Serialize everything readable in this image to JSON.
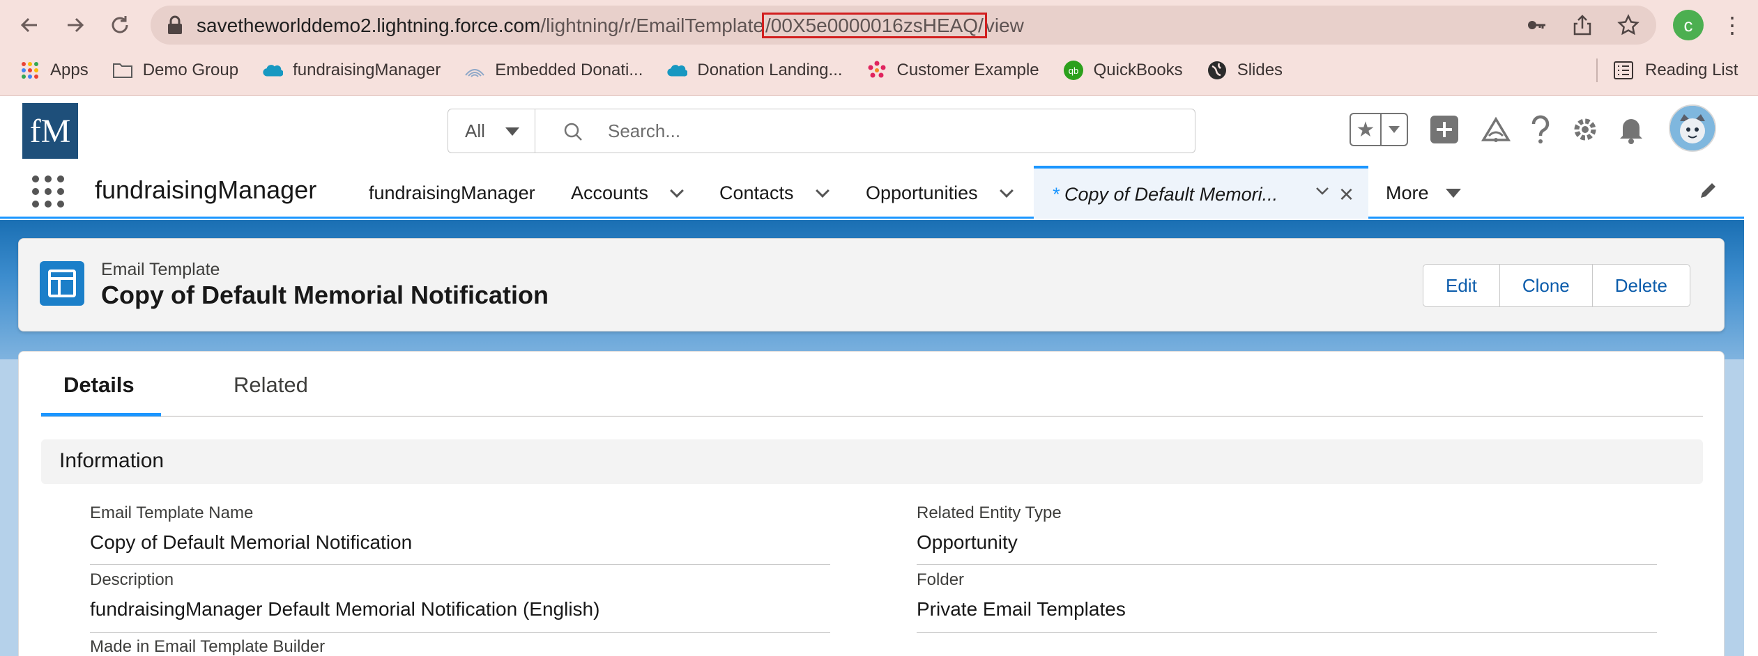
{
  "browser": {
    "url_host": "savetheworlddemo2.lightning.force.com",
    "url_path_prefix": "/lightning/r/EmailTemplate",
    "url_highlight": "/00X5e0000016zsHEAQ/",
    "url_suffix": "view",
    "profile_initial": "c",
    "bookmarks": [
      {
        "label": "Apps",
        "icon": "apps-grid-icon"
      },
      {
        "label": "Demo Group",
        "icon": "folder-icon"
      },
      {
        "label": "fundraisingManager",
        "icon": "salesforce-cloud-icon"
      },
      {
        "label": "Embedded Donati...",
        "icon": "waves-icon"
      },
      {
        "label": "Donation Landing...",
        "icon": "salesforce-cloud-icon"
      },
      {
        "label": "Customer Example",
        "icon": "dots-flower-icon"
      },
      {
        "label": "QuickBooks",
        "icon": "quickbooks-icon"
      },
      {
        "label": "Slides",
        "icon": "globe-icon"
      }
    ],
    "reading_list": "Reading List"
  },
  "header": {
    "logo": "fM",
    "search_scope": "All",
    "search_placeholder": "Search..."
  },
  "appnav": {
    "app_name": "fundraisingManager",
    "items": [
      {
        "label": "fundraisingManager"
      },
      {
        "label": "Accounts"
      },
      {
        "label": "Contacts"
      },
      {
        "label": "Opportunities"
      }
    ],
    "active_tab_marker": "*",
    "active_tab": "Copy of Default Memori...",
    "more": "More"
  },
  "record": {
    "type": "Email Template",
    "title": "Copy of Default Memorial Notification",
    "actions": {
      "edit": "Edit",
      "clone": "Clone",
      "delete": "Delete"
    }
  },
  "detail": {
    "tabs": {
      "details": "Details",
      "related": "Related"
    },
    "section_title": "Information",
    "fields": {
      "name_label": "Email Template Name",
      "name_value": "Copy of Default Memorial Notification",
      "entity_label": "Related Entity Type",
      "entity_value": "Opportunity",
      "desc_label": "Description",
      "desc_value": "fundraisingManager Default Memorial Notification (English)",
      "folder_label": "Folder",
      "folder_value": "Private Email Templates",
      "builder_label": "Made in Email Template Builder"
    }
  },
  "colors": {
    "brand_blue": "#1b96ff",
    "button_text": "#0b5cab",
    "url_highlight_border": "#d21f1f"
  }
}
